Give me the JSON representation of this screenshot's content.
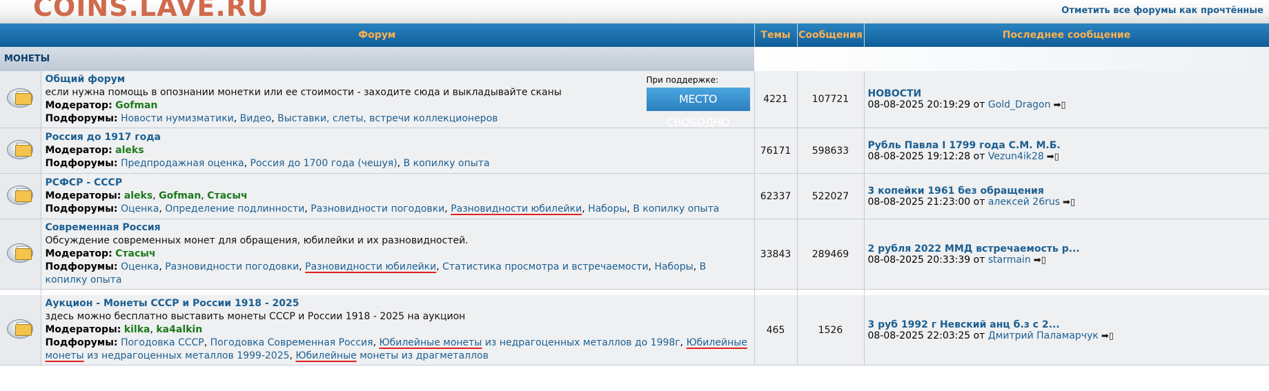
{
  "header": {
    "logo": "COINS.LAVE.RU",
    "mark_all_read": "Отметить все форумы как прочтённые"
  },
  "columns": {
    "forum": "Форум",
    "topics": "Темы",
    "posts": "Сообщения",
    "last_post": "Последнее сообщение"
  },
  "category": {
    "name": "МОНЕТЫ"
  },
  "sponsor": {
    "label": "При поддержке:",
    "banner": "МЕСТО СВОБОДНО"
  },
  "forums": [
    {
      "title": "Общий форум",
      "desc": "если нужна помощь в опознании монетки или ее стоимости - заходите сюда и выкладывайте сканы",
      "mod_label": "Модератор:",
      "mods": [
        "Gofman"
      ],
      "sub_label": "Подфорумы:",
      "subs": [
        "Новости нумизматики",
        "Видео",
        "Выставки, слеты, встречи коллекционеров"
      ],
      "topics": "4221",
      "posts": "107721",
      "last_title": "НОВОСТИ",
      "last_date": "08-08-2025 20:19:29",
      "last_by": "от",
      "last_user": "Gold_Dragon"
    },
    {
      "title": "Россия до 1917 года",
      "mod_label": "Модератор:",
      "mods": [
        "aleks"
      ],
      "sub_label": "Подфорумы:",
      "subs": [
        "Предпродажная оценка",
        "Россия до 1700 года (чешуя)",
        "В копилку опыта"
      ],
      "topics": "76171",
      "posts": "598633",
      "last_title": "Рубль Павла I 1799 года С.М. М.Б.",
      "last_date": "08-08-2025 19:12:28",
      "last_by": "от",
      "last_user": "Vezun4ik28"
    },
    {
      "title": "РСФСР - СССР",
      "mod_label": "Модераторы:",
      "mods": [
        "aleks",
        "Gofman",
        "Стасыч"
      ],
      "sub_label": "Подфорумы:",
      "subs": [
        "Оценка",
        "Определение подлинности",
        "Разновидности погодовки",
        "Разновидности юбилейки",
        "Наборы",
        "В копилку опыта"
      ],
      "topics": "62337",
      "posts": "522027",
      "last_title": "3 копейки 1961 без обращения",
      "last_date": "08-08-2025 21:23:00",
      "last_by": "от",
      "last_user": "алексей 26rus"
    },
    {
      "title": "Современная Россия",
      "desc": "Обсуждение современных монет для обращения, юбилейки и их разновидностей.",
      "mod_label": "Модератор:",
      "mods": [
        "Стасыч"
      ],
      "sub_label": "Подфорумы:",
      "subs": [
        "Оценка",
        "Разновидности погодовки",
        "Разновидности юбилейки",
        "Статистика просмотра и встречаемости",
        "Наборы",
        "В копилку опыта"
      ],
      "topics": "33843",
      "posts": "289469",
      "last_title": "2 рубля 2022 ММД встречаемость р...",
      "last_date": "08-08-2025 20:33:39",
      "last_by": "от",
      "last_user": "starmain"
    },
    {
      "title": "Аукцион - Монеты СССР и России 1918 - 2025",
      "desc": "здесь можно бесплатно выставить монеты СССР и России 1918 - 2025 на аукцион",
      "mod_label": "Модераторы:",
      "mods": [
        "kilka",
        "ka4alkin"
      ],
      "sub_label": "Подфорумы:",
      "subs": [
        "Погодовка СССР",
        "Погодовка Современная Россия",
        "Юбилейные монеты",
        "из недрагоценных металлов до 1998г",
        "Юбилейные монеты",
        "из недрагоценных металлов 1999-2025",
        "Юбилейные",
        "монеты из драгметаллов"
      ],
      "topics": "465",
      "posts": "1526",
      "last_title": "3 руб 1992 г Невский анц б.з с 2...",
      "last_date": "08-08-2025 22:03:25",
      "last_by": "от",
      "last_user": "Дмитрий Паламарчук"
    }
  ]
}
